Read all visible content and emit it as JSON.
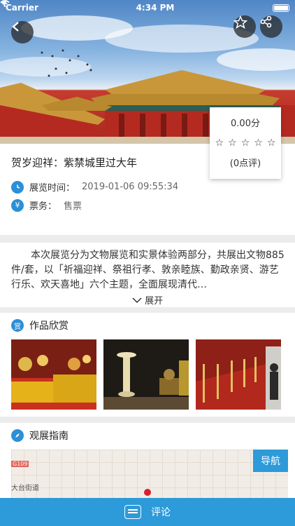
{
  "status_bar": {
    "carrier": "Carrier",
    "time": "4:34 PM"
  },
  "hero": {
    "back_icon": "chevron-left-icon",
    "favorite_icon": "star-outline-icon",
    "share_icon": "share-icon"
  },
  "rating": {
    "score": "0.00分",
    "stars": [
      "☆",
      "☆",
      "☆",
      "☆",
      "☆"
    ],
    "count": "(0点评)"
  },
  "exhibition": {
    "title": "贺岁迎祥：紫禁城里过大年",
    "time_label": "展览时间：",
    "time_value": "2019-01-06 09:55:34",
    "ticket_label": "票务：",
    "ticket_value": "售票"
  },
  "description": {
    "text": "本次展览分为文物展览和实景体验两部分，共展出文物885件/套，以「祈福迎祥、祭祖行孝、敦亲睦族、勤政亲贤、游艺行乐、欢天喜地」六个主题，全面展现清代…",
    "expand_label": "展开"
  },
  "works": {
    "title": "作品欣赏",
    "badge": "赏"
  },
  "guide": {
    "title": "观展指南",
    "nav_label": "导航",
    "road_tag": "G109",
    "street": "大台街道"
  },
  "bottom_bar": {
    "comment_label": "评论"
  },
  "colors": {
    "accent": "#2d9ad9",
    "pin": "#d6202a"
  }
}
